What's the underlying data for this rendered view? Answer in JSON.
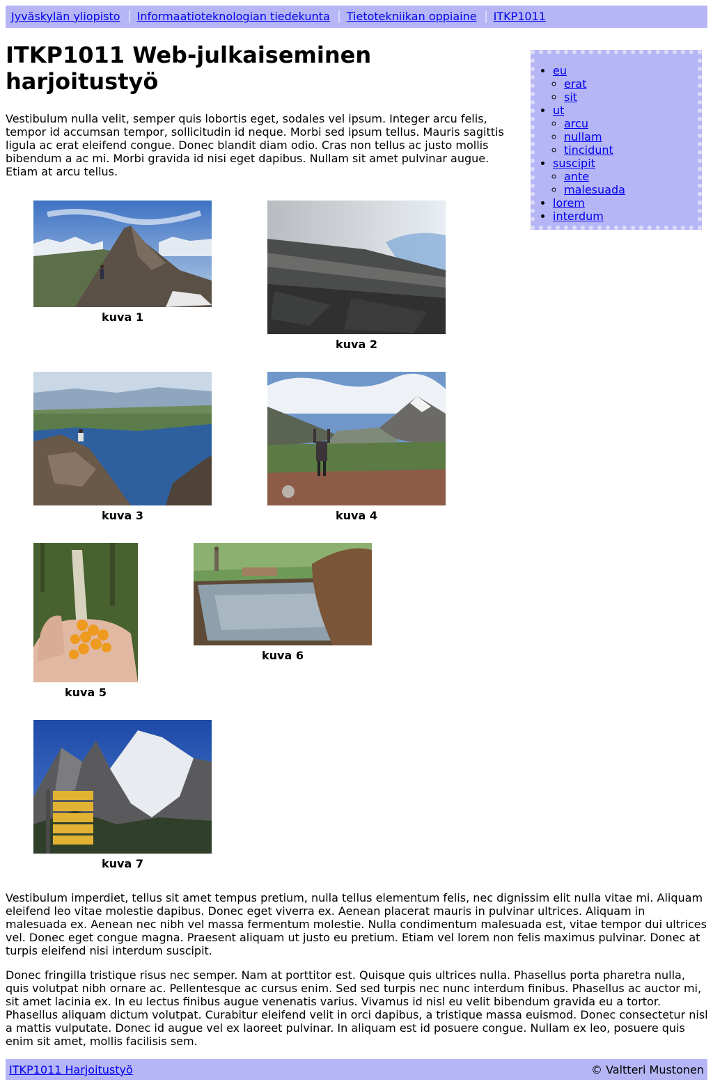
{
  "breadcrumb": [
    "Jyväskylän yliopisto",
    "Informaatioteknologian tiedekunta",
    "Tietotekniikan oppiaine",
    "ITKP1011"
  ],
  "title": "ITKP1011 Web-julkaiseminen harjoitustyö",
  "intro": "Vestibulum nulla velit, semper quis lobortis eget, sodales vel ipsum. Integer arcu felis, tempor id accumsan tempor, sollicitudin id neque. Morbi sed ipsum tellus. Mauris sagittis ligula ac erat eleifend congue. Donec blandit diam odio. Cras non tellus ac justo mollis bibendum a ac mi. Morbi gravida id nisi eget dapibus. Nullam sit amet pulvinar augue. Etiam at arcu tellus.",
  "side_nav": [
    {
      "label": "eu",
      "children": [
        "erat",
        "sit"
      ]
    },
    {
      "label": "ut",
      "children": [
        "arcu",
        "nullam",
        "tincidunt"
      ]
    },
    {
      "label": "suscipit",
      "children": [
        "ante",
        "malesuada"
      ]
    },
    {
      "label": "lorem",
      "children": []
    },
    {
      "label": "interdum",
      "children": []
    }
  ],
  "figures": [
    {
      "caption": "kuva 1",
      "scene": "mountain-ridge-hiker"
    },
    {
      "caption": "kuva 2",
      "scene": "foggy-rock-slope"
    },
    {
      "caption": "kuva 3",
      "scene": "lake-view-sitter"
    },
    {
      "caption": "kuva 4",
      "scene": "valley-arms-raised"
    },
    {
      "caption": "kuva 5",
      "scene": "cloudberries-in-hand"
    },
    {
      "caption": "kuva 6",
      "scene": "wooden-water-trough"
    },
    {
      "caption": "kuva 7",
      "scene": "snowy-peak-signpost"
    }
  ],
  "paragraphs": [
    "Vestibulum imperdiet, tellus sit amet tempus pretium, nulla tellus elementum felis, nec dignissim elit nulla vitae mi. Aliquam eleifend leo vitae molestie dapibus. Donec eget viverra ex. Aenean placerat mauris in pulvinar ultrices. Aliquam in malesuada ex. Aenean nec nibh vel massa fermentum molestie. Nulla condimentum malesuada est, vitae tempor dui ultrices vel. Donec eget congue magna. Praesent aliquam ut justo eu pretium. Etiam vel lorem non felis maximus pulvinar. Donec at turpis eleifend nisi interdum suscipit.",
    "Donec fringilla tristique risus nec semper. Nam at porttitor est. Quisque quis ultrices nulla. Phasellus porta pharetra nulla, quis volutpat nibh ornare ac. Pellentesque ac cursus enim. Sed sed turpis nec nunc interdum finibus. Phasellus ac auctor mi, sit amet lacinia ex. In eu lectus finibus augue venenatis varius. Vivamus id nisl eu velit bibendum gravida eu a tortor. Phasellus aliquam dictum volutpat. Curabitur eleifend velit in orci dapibus, a tristique massa euismod. Donec consectetur nisl a mattis vulputate. Donec id augue vel ex laoreet pulvinar. In aliquam est id posuere congue. Nullam ex leo, posuere quis enim sit amet, mollis facilisis sem."
  ],
  "footer": {
    "link": "ITKP1011 Harjoitustyö",
    "copyright": "© Valtteri Mustonen"
  },
  "colors": {
    "bar_background": "#b6b6f6",
    "link": "#0000ee"
  }
}
